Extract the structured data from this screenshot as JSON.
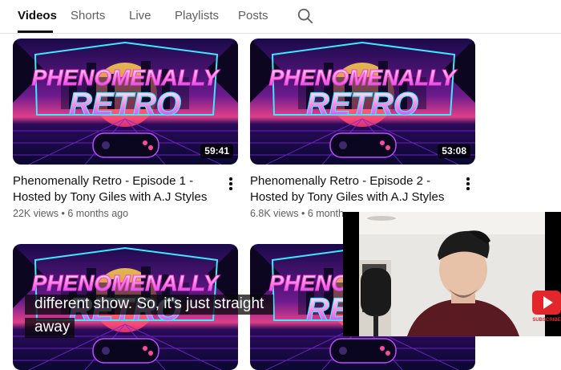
{
  "tabs": [
    {
      "label": "Videos",
      "active": true
    },
    {
      "label": "Shorts"
    },
    {
      "label": "Live"
    },
    {
      "label": "Playlists"
    },
    {
      "label": "Posts"
    }
  ],
  "search": {
    "icon": "search-icon"
  },
  "thumbnail": {
    "line1": "PHENOMENALLY",
    "line2": "RETRO"
  },
  "videos": [
    {
      "title_line1": "Phenomenally Retro - Episode 1 -",
      "title_line2": "Hosted by Tony Giles with A.J Styles",
      "views": "22K views",
      "separator": "•",
      "age": "6 months ago",
      "duration": "59:41"
    },
    {
      "title_line1": "Phenomenally Retro - Episode 2 -",
      "title_line2": "Hosted by Tony Giles with A.J Styles",
      "views": "6.8K views",
      "separator": "•",
      "age": "6 month",
      "duration": "53:08"
    }
  ],
  "captions": [
    "different show. So, it's just straight",
    "away"
  ],
  "pip_player": {
    "subscribe_label": "SUBSCRIBE"
  },
  "colors": {
    "accent": "#0f0f0f",
    "secondary_text": "#606060",
    "subscribe_red": "#e3262b"
  }
}
